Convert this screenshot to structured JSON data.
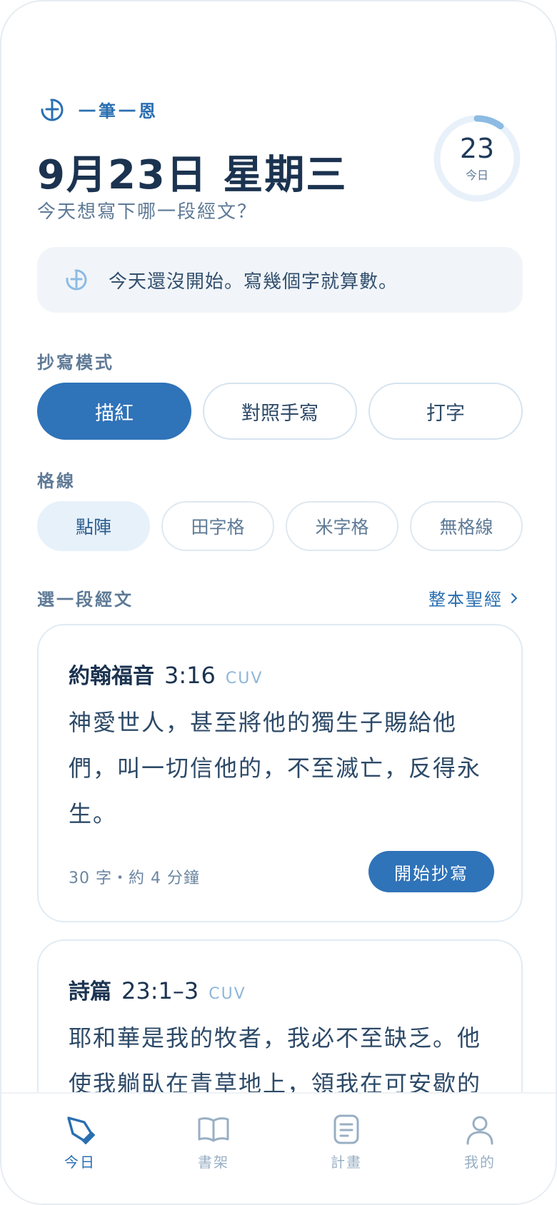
{
  "app": {
    "brand_name": "一筆一恩"
  },
  "header": {
    "date_title": "9月23日  星期三",
    "subtitle": "今天想寫下哪一段經文？",
    "progress": {
      "value": "23",
      "label": "今日",
      "fill_fraction": 0.1
    }
  },
  "banner": {
    "text": "今天還沒開始。寫幾個字就算數。"
  },
  "mode": {
    "label": "抄寫模式",
    "options": [
      "描紅",
      "對照手寫",
      "打字"
    ],
    "selected": "描紅"
  },
  "gridlines": {
    "label": "格線",
    "options": [
      "點陣",
      "田字格",
      "米字格",
      "無格線"
    ],
    "selected": "點陣"
  },
  "passages": {
    "label": "選一段經文",
    "link": "整本聖經",
    "items": [
      {
        "book": "約翰福音",
        "ref": "3:16",
        "version": "CUV",
        "verse": "神愛世人，甚至將他的獨生子賜給他們，叫一切信他的，不至滅亡，反得永生。",
        "meta": "30 字・約 4 分鐘",
        "cta": "開始抄寫"
      },
      {
        "book": "詩篇",
        "ref": "23:1–3",
        "version": "CUV",
        "verse": "耶和華是我的牧者，我必不至缺乏。他使我躺臥在青草地上，領我在可安歇的"
      }
    ]
  },
  "tabs": [
    {
      "label": "今日",
      "icon": "pen-nib-icon"
    },
    {
      "label": "書架",
      "icon": "book-icon"
    },
    {
      "label": "計畫",
      "icon": "plan-list-icon"
    },
    {
      "label": "我的",
      "icon": "person-icon"
    }
  ],
  "colors": {
    "accent": "#2f73b9",
    "text": "#1b3350",
    "muted": "#5e7a96"
  }
}
